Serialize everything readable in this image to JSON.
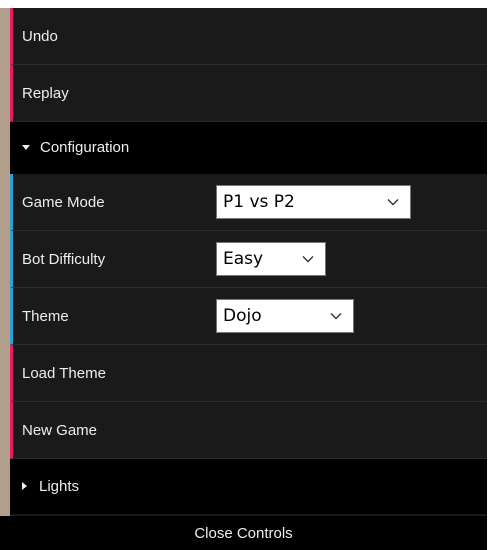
{
  "controls": {
    "undo_label": "Undo",
    "replay_label": "Replay",
    "configuration": {
      "title": "Configuration",
      "game_mode": {
        "label": "Game Mode",
        "value": "P1 vs P2"
      },
      "bot_difficulty": {
        "label": "Bot Difficulty",
        "value": "Easy"
      },
      "theme": {
        "label": "Theme",
        "value": "Dojo"
      },
      "load_theme_label": "Load Theme",
      "new_game_label": "New Game"
    },
    "lights": {
      "title": "Lights"
    },
    "close_label": "Close Controls"
  },
  "colors": {
    "button_accent": "#e61d5f",
    "option_accent": "#2fa1d6",
    "row_background": "#1a1a1a",
    "folder_background": "#000000",
    "text": "#eeeeee"
  },
  "icons": {
    "configuration_toggle": "caret-down-icon",
    "lights_toggle": "caret-right-icon",
    "select_arrow": "chevron-down-icon"
  }
}
